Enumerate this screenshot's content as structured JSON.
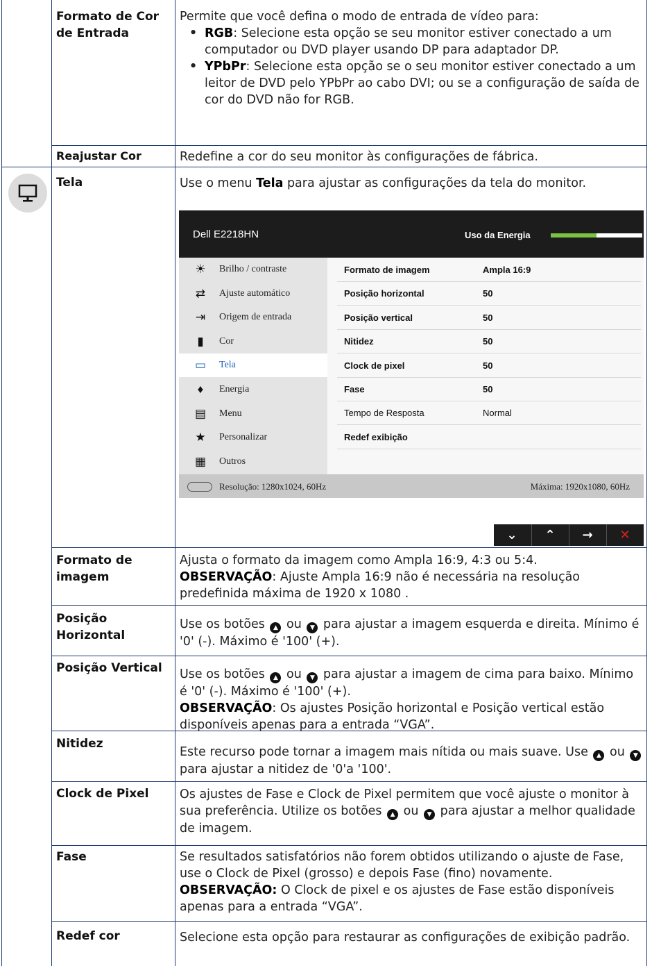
{
  "rows": {
    "formato_cor": {
      "term": "Formato de Cor de Entrada",
      "intro": "Permite que você defina o modo de entrada de vídeo para:",
      "bullets": [
        {
          "key": "RGB",
          "text": ": Selecione esta opção se seu monitor estiver conectado a um computador ou DVD player usando DP para adaptador DP."
        },
        {
          "key": "YPbPr",
          "text": ": Selecione esta opção se o seu monitor estiver conectado a um leitor de DVD pelo YPbPr ao cabo DVI; ou se a configuração de saída de cor do DVD não for RGB."
        }
      ]
    },
    "reajustar_cor": {
      "term": "Reajustar Cor",
      "desc": "Redefine a cor do seu monitor às configurações de fábrica."
    },
    "tela": {
      "term": "Tela",
      "desc_pre": "Use o menu ",
      "desc_bold": "Tela",
      "desc_post": " para ajustar as configurações da tela do monitor."
    },
    "formato_imagem": {
      "term": "Formato de imagem",
      "desc1": "Ajusta o formato da imagem como Ampla 16:9, 4:3 ou 5:4.",
      "note_label": "OBSERVAÇÃO",
      "note_text": ": Ajuste Ampla 16:9 não é necessária na resolução predefinida máxima de 1920 x 1080 ."
    },
    "posicao_horizontal": {
      "term": "Posição Horizontal",
      "pre": "Use os botões ",
      "mid": " ou ",
      "post": " para ajustar a imagem esquerda e direita. Mínimo é '0' (-). Máximo é '100' (+)."
    },
    "posicao_vertical": {
      "term": "Posição Vertical",
      "pre": " Use os botões ",
      "mid": " ou ",
      "post": " para ajustar a imagem de cima para baixo. Mínimo é '0' (-). Máximo é '100' (+).",
      "note_label": "OBSERVAÇÃO",
      "note_text": ": Os ajustes Posição horizontal e Posição vertical estão disponíveis apenas para a entrada “VGA”."
    },
    "nitidez": {
      "term": "Nitidez",
      "pre": "Este recurso pode tornar a imagem mais nítida ou mais suave. Use ",
      "mid": " ou ",
      "post": " para ajustar a nitidez de '0'a '100'."
    },
    "clock_pixel": {
      "term": "Clock de Pixel",
      "pre": "Os ajustes de Fase e Clock de Pixel permitem que você ajuste o monitor à sua preferência. Utilize os botões ",
      "mid": " ou ",
      "post": " para ajustar a melhor qualidade de imagem."
    },
    "fase": {
      "term": "Fase",
      "desc": "Se resultados satisfatórios não forem obtidos utilizando o ajuste de Fase, use o Clock de Pixel (grosso) e depois Fase (fino) novamente.",
      "note_label": "OBSERVAÇÃO:",
      "note_text": " O Clock de pixel e os ajustes de Fase estão disponíveis apenas para a entrada “VGA”."
    },
    "redef_cor": {
      "term": "Redef cor",
      "desc": "Selecione esta opção para restaurar as configurações de exibição padrão."
    }
  },
  "osd": {
    "model": "Dell E2218HN",
    "energy_label": "Uso da Energia",
    "energy_level": 0.5,
    "menu": [
      {
        "icon": "brightness-icon",
        "glyph": "☀",
        "label": "Brilho / contraste",
        "active": false
      },
      {
        "icon": "auto-adjust-icon",
        "glyph": "⇄",
        "label": "Ajuste automático",
        "active": false
      },
      {
        "icon": "input-source-icon",
        "glyph": "⇥",
        "label": "Origem de entrada",
        "active": false
      },
      {
        "icon": "color-icon",
        "glyph": "▮",
        "label": "Cor",
        "active": false
      },
      {
        "icon": "display-icon",
        "glyph": "▭",
        "label": "Tela",
        "active": true
      },
      {
        "icon": "energy-icon",
        "glyph": "♦",
        "label": "Energia",
        "active": false
      },
      {
        "icon": "menu-icon",
        "glyph": "▤",
        "label": "Menu",
        "active": false
      },
      {
        "icon": "star-icon",
        "glyph": "★",
        "label": "Personalizar",
        "active": false
      },
      {
        "icon": "others-icon",
        "glyph": "▦",
        "label": "Outros",
        "active": false
      }
    ],
    "settings": [
      {
        "label": "Formato de imagem",
        "value": "Ampla 16:9",
        "bold": true
      },
      {
        "label": "Posição horizontal",
        "value": "50",
        "bold": true
      },
      {
        "label": "Posição vertical",
        "value": "50",
        "bold": true
      },
      {
        "label": "Nitidez",
        "value": "50",
        "bold": true
      },
      {
        "label": "Clock de pixel",
        "value": "50",
        "bold": true
      },
      {
        "label": "Fase",
        "value": "50",
        "bold": true
      },
      {
        "label": "Tempo de Resposta",
        "value": "Normal",
        "bold": false
      },
      {
        "label": "Redef exibição",
        "value": "",
        "bold": true
      }
    ],
    "resolution": "Resolução: 1280x1024, 60Hz",
    "max_resolution": "Máxima: 1920x1080, 60Hz",
    "buttons": [
      {
        "name": "down-button",
        "glyph": "⌄"
      },
      {
        "name": "up-button",
        "glyph": "⌃"
      },
      {
        "name": "next-button",
        "glyph": "→"
      },
      {
        "name": "exit-button",
        "glyph": "✕"
      }
    ]
  },
  "colors": {
    "border": "#1f3a6e",
    "energy_green": "#7bc143",
    "active_menu": "#1a63b8",
    "exit_red": "#e02020"
  }
}
